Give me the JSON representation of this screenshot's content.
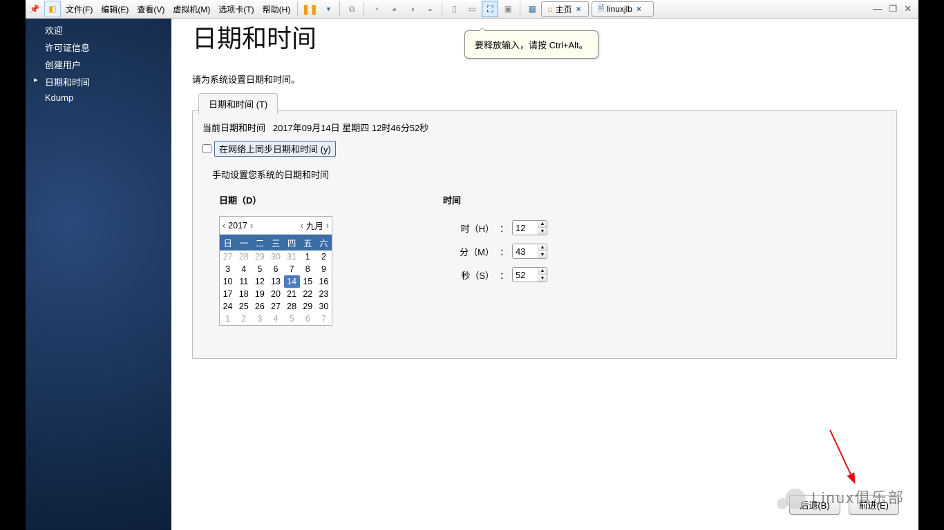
{
  "menus": [
    "文件(F)",
    "编辑(E)",
    "查看(V)",
    "虚拟机(M)",
    "选项卡(T)",
    "帮助(H)"
  ],
  "tabs": {
    "home": "主页",
    "vm": "linuxjlb"
  },
  "tooltip": "要释放输入，请按 Ctrl+Alt。",
  "sidebar": [
    "欢迎",
    "许可证信息",
    "创建用户",
    "日期和时间",
    "Kdump"
  ],
  "sidebar_active": 3,
  "page": {
    "title": "日期和时间",
    "desc": "请为系统设置日期和时间。",
    "tab": "日期和时间 (T)",
    "current_label": "当前日期和时间",
    "current_value": "2017年09月14日   星期四   12时46分52秒",
    "sync": "在网络上同步日期和时间 (y)",
    "manual": "手动设置您系统的日期和时间",
    "date_label": "日期（D）",
    "time_label": "时间",
    "hour": "时（H）",
    "min": "分（M）",
    "sec": "秒（S）",
    "h": "12",
    "m": "43",
    "s": "52",
    "back": "后退(B)",
    "forward": "前进(E)"
  },
  "cal": {
    "year": "2017",
    "month": "九月",
    "dow": [
      "日",
      "一",
      "二",
      "三",
      "四",
      "五",
      "六"
    ],
    "cells": [
      {
        "n": 27,
        "m": 1
      },
      {
        "n": 28,
        "m": 1
      },
      {
        "n": 29,
        "m": 1
      },
      {
        "n": 30,
        "m": 1
      },
      {
        "n": 31,
        "m": 1
      },
      {
        "n": 1
      },
      {
        "n": 2
      },
      {
        "n": 3
      },
      {
        "n": 4
      },
      {
        "n": 5
      },
      {
        "n": 6
      },
      {
        "n": 7
      },
      {
        "n": 8
      },
      {
        "n": 9
      },
      {
        "n": 10
      },
      {
        "n": 11
      },
      {
        "n": 12
      },
      {
        "n": 13
      },
      {
        "n": 14,
        "sel": 1
      },
      {
        "n": 15
      },
      {
        "n": 16
      },
      {
        "n": 17
      },
      {
        "n": 18
      },
      {
        "n": 19
      },
      {
        "n": 20
      },
      {
        "n": 21
      },
      {
        "n": 22
      },
      {
        "n": 23
      },
      {
        "n": 24
      },
      {
        "n": 25
      },
      {
        "n": 26
      },
      {
        "n": 27
      },
      {
        "n": 28
      },
      {
        "n": 29
      },
      {
        "n": 30
      },
      {
        "n": 1,
        "m": 1
      },
      {
        "n": 2,
        "m": 1
      },
      {
        "n": 3,
        "m": 1
      },
      {
        "n": 4,
        "m": 1
      },
      {
        "n": 5,
        "m": 1
      },
      {
        "n": 6,
        "m": 1
      },
      {
        "n": 7,
        "m": 1
      }
    ]
  },
  "watermark": "Linux俱乐部"
}
